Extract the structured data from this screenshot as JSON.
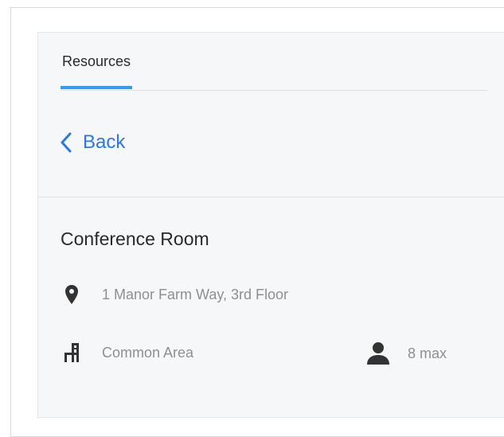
{
  "tabs": [
    {
      "label": "Resources",
      "active": true
    }
  ],
  "nav": {
    "back_label": "Back"
  },
  "room": {
    "name": "Conference Room",
    "address": "1 Manor Farm Way, 3rd Floor",
    "area": "Common Area",
    "capacity": "8 max"
  },
  "icons": {
    "back": "chevron-left-icon",
    "address": "map-pin-icon",
    "area": "chair-icon",
    "capacity": "person-icon"
  },
  "colors": {
    "accent": "#2d9ff3",
    "link": "#2a7ae2",
    "icon": "#333333",
    "muted_text": "#8f8f8f",
    "panel_bg": "#f6f7f9"
  }
}
